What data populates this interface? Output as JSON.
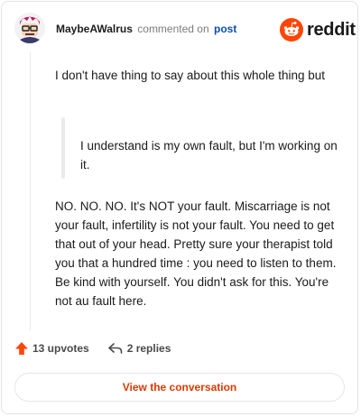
{
  "header": {
    "username": "MaybeAWalrus",
    "commented_text": "commented on",
    "post_link": "post",
    "brand": "reddit"
  },
  "comment": {
    "paragraph1": "I don't have thing to say about this whole thing but",
    "quote": "I understand is my own fault, but I'm working on it.",
    "paragraph2": "NO. NO. NO. It's NOT your fault. Miscarriage is not your fault, infertility is not your fault. You need to get that out of your head. Pretty sure your therapist told you that a hundred time : you need to listen to them. Be kind with yourself. You didn't ask for this. You're not au fault here."
  },
  "actions": {
    "upvotes": "13 upvotes",
    "replies": "2 replies"
  },
  "cta": {
    "label": "View the conversation"
  },
  "colors": {
    "brand_orange": "#ff4500",
    "link_blue": "#0a4fa8",
    "cta_text": "#d93a00",
    "avatar_accent": "#c2185b"
  },
  "icons": {
    "brand": "reddit-snoo-icon",
    "upvote": "upvote-arrow-icon",
    "reply": "reply-arrow-icon"
  }
}
